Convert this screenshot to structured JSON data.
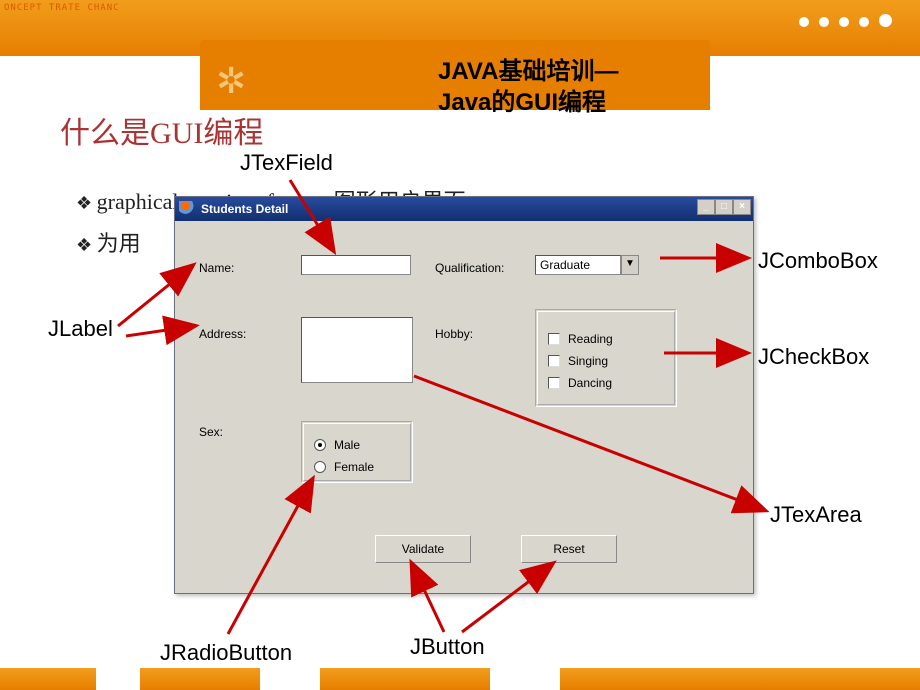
{
  "page_header": {
    "line1": "JAVA基础培训—",
    "line2": "Java的GUI编程"
  },
  "slide_title": "什么是GUI编程",
  "bullets": {
    "b1": "graphical user interfaces，图形用户界面",
    "b2": "为用"
  },
  "window": {
    "title": "Students Detail",
    "labels": {
      "name": "Name:",
      "address": "Address:",
      "sex": "Sex:",
      "qualification": "Qualification:",
      "hobby": "Hobby:"
    },
    "combo": {
      "selected": "Graduate"
    },
    "checkboxes": {
      "c1": "Reading",
      "c2": "Singing",
      "c3": "Dancing"
    },
    "radios": {
      "r1": "Male",
      "r2": "Female"
    },
    "buttons": {
      "validate": "Validate",
      "reset": "Reset"
    }
  },
  "annotations": {
    "jtexfield": "JTexField",
    "jlabel": "JLabel",
    "jcombobox": "JComboBox",
    "jcheckbox": "JCheckBox",
    "jtexarea": "JTexArea",
    "jradiobutton": "JRadioButton",
    "jbutton": "JButton"
  },
  "corner_logo": "ONCEPT\nTRATE\nCHANC",
  "colors": {
    "accent": "#e67e00",
    "arrow": "#c80000"
  }
}
